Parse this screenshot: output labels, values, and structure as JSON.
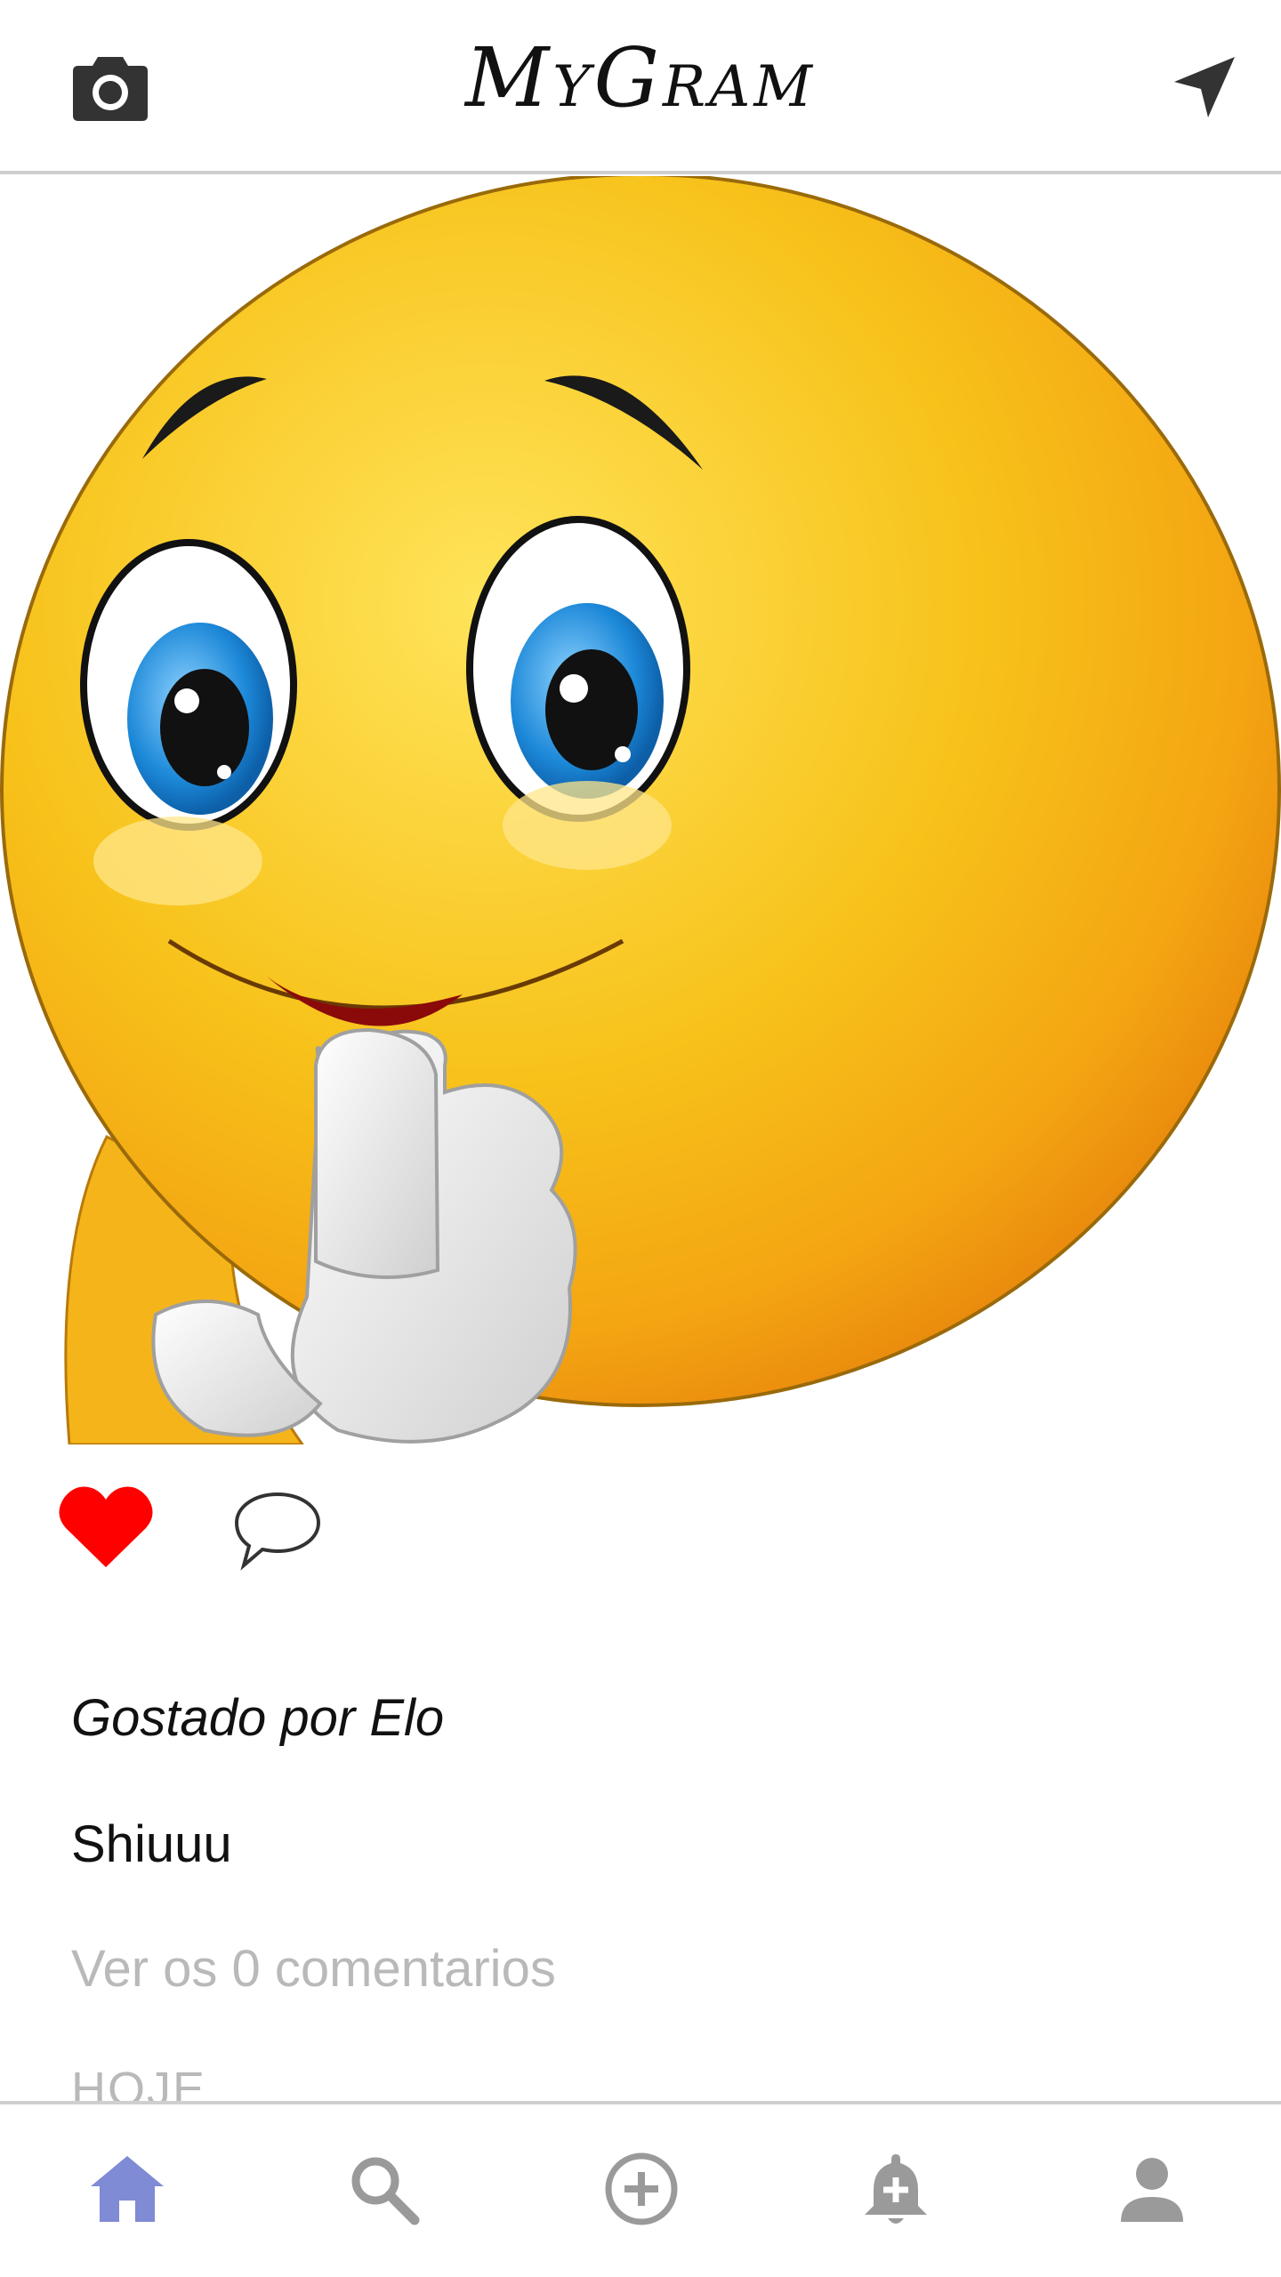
{
  "header": {
    "brand": "MyGram",
    "camera_icon": "camera-icon",
    "send_icon": "send-icon"
  },
  "post": {
    "image_alt": "winking emoji with finger over lips",
    "likes_text": "Gostado por Elo",
    "caption": "Shiuuu",
    "comments_link": "Ver os 0 comentarios",
    "date_label": "HOJE",
    "liked": true
  },
  "nav": {
    "items": [
      {
        "name": "home",
        "icon": "home-icon",
        "active": true
      },
      {
        "name": "search",
        "icon": "search-icon",
        "active": false
      },
      {
        "name": "add",
        "icon": "add-circle-icon",
        "active": false
      },
      {
        "name": "notifications",
        "icon": "bell-plus-icon",
        "active": false
      },
      {
        "name": "profile",
        "icon": "person-icon",
        "active": false
      }
    ],
    "active_color": "#7f8bd4",
    "inactive_color": "#9a9a9a"
  },
  "colors": {
    "like_red": "#ff0000",
    "icon_dark": "#333333"
  }
}
